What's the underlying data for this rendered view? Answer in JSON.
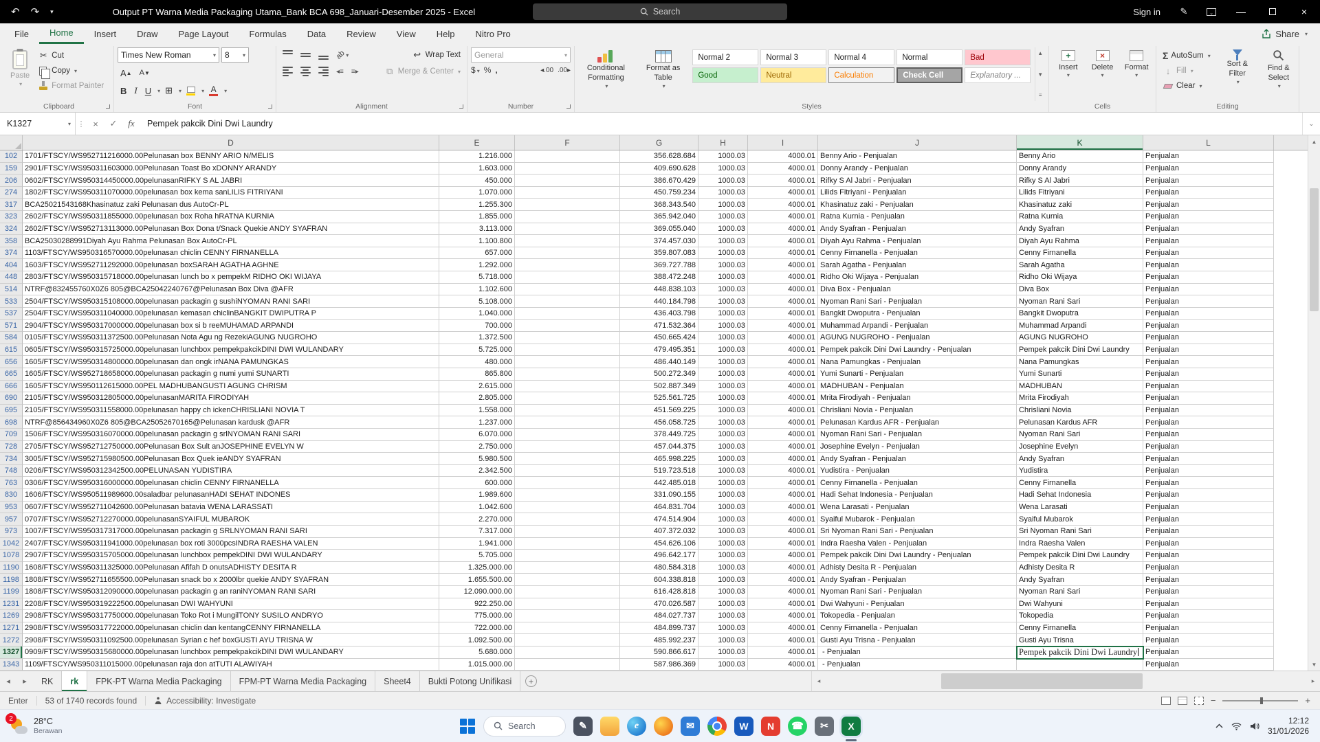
{
  "theme": {
    "excel_green": "#217346",
    "selection_green": "#1e7145",
    "titlebar_black": "#000000",
    "row_number_blue": "#3a66a7"
  },
  "titlebar": {
    "title": "Output PT Warna Media Packaging Utama_Bank BCA 698_Januari-Desember 2025  -  Excel",
    "search_placeholder": "Search",
    "sign_in": "Sign in"
  },
  "ribbon": {
    "tabs": [
      "File",
      "Home",
      "Insert",
      "Draw",
      "Page Layout",
      "Formulas",
      "Data",
      "Review",
      "View",
      "Help",
      "Nitro Pro"
    ],
    "active_tab": "Home",
    "share_label": "Share",
    "clipboard": {
      "label": "Clipboard",
      "paste": "Paste",
      "cut": "Cut",
      "copy": "Copy",
      "format_painter": "Format Painter"
    },
    "font": {
      "label": "Font",
      "font_name": "Times New Roman",
      "font_size": "8"
    },
    "alignment": {
      "label": "Alignment",
      "wrap_text": "Wrap Text",
      "merge_center": "Merge & Center"
    },
    "number": {
      "label": "Number",
      "format": "General"
    },
    "styles": {
      "label": "Styles",
      "conditional": "Conditional Formatting",
      "format_table": "Format as Table",
      "gallery_row1": [
        "Normal 2",
        "Normal 3",
        "Normal 4",
        "Normal",
        "Bad"
      ],
      "gallery_row2": [
        "Good",
        "Neutral",
        "Calculation",
        "Check Cell",
        "Explanatory ..."
      ]
    },
    "cells": {
      "label": "Cells",
      "items": [
        "Insert",
        "Delete",
        "Format"
      ]
    },
    "editing": {
      "label": "Editing",
      "autosum": "AutoSum",
      "fill": "Fill",
      "clear": "Clear",
      "sort": "Sort & Filter",
      "find": "Find & Select"
    }
  },
  "formula_bar": {
    "name_box": "K1327",
    "formula": "Pempek pakcik Dini Dwi Laundry"
  },
  "grid": {
    "columns": [
      "D",
      "E",
      "F",
      "G",
      "H",
      "I",
      "J",
      "K",
      "L"
    ],
    "selected": {
      "row": "1327",
      "col": "K"
    },
    "h_value": "1000.03",
    "i_value": "4000.01",
    "l_value": "Penjualan",
    "rows": [
      {
        "n": "102",
        "d": "1701/FTSCY/WS952711216000.00Pelunasan box BENNY ARIO N/MELIS",
        "e": "1.216.000",
        "g": "356.628.684",
        "j": "Benny Ario - Penjualan",
        "k": "Benny Ario"
      },
      {
        "n": "159",
        "d": "2901/FTSCY/WS950311603000.00Pelunasan Toast Bo xDONNY ARANDY",
        "e": "1.603.000",
        "g": "409.690.628",
        "j": "Donny Arandy - Penjualan",
        "k": "Donny Arandy"
      },
      {
        "n": "206",
        "d": "0602/FTSCY/WS950314450000.00pelunasanRIFKY S AL JABRI",
        "e": "450.000",
        "g": "386.670.429",
        "j": "Rifky S Al Jabri - Penjualan",
        "k": "Rifky S Al Jabri"
      },
      {
        "n": "274",
        "d": "1802/FTSCY/WS950311070000.00pelunasan box kema sanLILIS FITRIYANI",
        "e": "1.070.000",
        "g": "450.759.234",
        "j": "Lilids Fitriyani - Penjualan",
        "k": "Lilids Fitriyani"
      },
      {
        "n": "317",
        "d": "BCA25021543168Khasinatuz zaki Pelunasan dus AutoCr-PL",
        "e": "1.255.300",
        "g": "368.343.540",
        "j": "Khasinatuz zaki - Penjualan",
        "k": "Khasinatuz zaki"
      },
      {
        "n": "323",
        "d": "2602/FTSCY/WS950311855000.00pelunasan box Roha hRATNA KURNIA",
        "e": "1.855.000",
        "g": "365.942.040",
        "j": "Ratna Kurnia - Penjualan",
        "k": "Ratna Kurnia"
      },
      {
        "n": "324",
        "d": "2602/FTSCY/WS952713113000.00Pelunasan Box Dona t/Snack Quekie ANDY SYAFRAN",
        "e": "3.113.000",
        "g": "369.055.040",
        "j": "Andy Syafran - Penjualan",
        "k": "Andy Syafran"
      },
      {
        "n": "358",
        "d": "BCA25030288991Diyah Ayu Rahma Pelunasan Box AutoCr-PL",
        "e": "1.100.800",
        "g": "374.457.030",
        "j": "Diyah Ayu Rahma - Penjualan",
        "k": "Diyah Ayu Rahma"
      },
      {
        "n": "374",
        "d": "1103/FTSCY/WS950316570000.00pelunasan chiclin CENNY FIRNANELLA",
        "e": "657.000",
        "g": "359.807.083",
        "j": "Cenny Firnanella - Penjualan",
        "k": "Cenny Firnanella"
      },
      {
        "n": "404",
        "d": "1603/FTSCY/WS952711292000.00pelunasan boxSARAH AGATHA AGHNE",
        "e": "1.292.000",
        "g": "369.727.788",
        "j": "Sarah Agatha - Penjualan",
        "k": "Sarah Agatha"
      },
      {
        "n": "448",
        "d": "2803/FTSCY/WS950315718000.00pelunasan lunch bo x pempekM RIDHO OKI WIJAYA",
        "e": "5.718.000",
        "g": "388.472.248",
        "j": "Ridho Oki Wijaya - Penjualan",
        "k": "Ridho Oki Wijaya"
      },
      {
        "n": "514",
        "d": "NTRF@832455760X0Z6 805@BCA25042240767@Pelunasan Box Diva @AFR",
        "e": "1.102.600",
        "g": "448.838.103",
        "j": "Diva Box - Penjualan",
        "k": "Diva Box"
      },
      {
        "n": "533",
        "d": "2504/FTSCY/WS950315108000.00pelunasan packagin g sushiNYOMAN RANI SARI",
        "e": "5.108.000",
        "g": "440.184.798",
        "j": "Nyoman Rani Sari - Penjualan",
        "k": "Nyoman Rani Sari"
      },
      {
        "n": "537",
        "d": "2504/FTSCY/WS950311040000.00pelunasan kemasan chiclinBANGKIT DWIPUTRA P",
        "e": "1.040.000",
        "g": "436.403.798",
        "j": "Bangkit Dwoputra - Penjualan",
        "k": "Bangkit Dwoputra"
      },
      {
        "n": "571",
        "d": "2904/FTSCY/WS950317000000.00pelunasan box si b reeMUHAMAD ARPANDI",
        "e": "700.000",
        "g": "471.532.364",
        "j": "Muhammad Arpandi - Penjualan",
        "k": "Muhammad Arpandi"
      },
      {
        "n": "584",
        "d": "0105/FTSCY/WS950311372500.00Pelunasan Nota Agu ng RezekiAGUNG NUGROHO",
        "e": "1.372.500",
        "g": "450.665.424",
        "j": "AGUNG NUGROHO - Penjualan",
        "k": "AGUNG NUGROHO"
      },
      {
        "n": "615",
        "d": "0605/FTSCY/WS950315725000.00pelunasan lunchbox pempekpakcikDINI DWI WULANDARY",
        "e": "5.725.000",
        "g": "479.495.351",
        "j": "Pempek pakcik Dini Dwi Laundry - Penjualan",
        "k": "Pempek pakcik Dini Dwi Laundry"
      },
      {
        "n": "656",
        "d": "1605/FTSCY/WS950314800000.00pelunasan dan ongk irNANA PAMUNGKAS",
        "e": "480.000",
        "g": "486.440.149",
        "j": "Nana Pamungkas - Penjualan",
        "k": "Nana Pamungkas"
      },
      {
        "n": "665",
        "d": "1605/FTSCY/WS952718658000.00pelunasan packagin g numi yumi SUNARTI",
        "e": "865.800",
        "g": "500.272.349",
        "j": "Yumi Sunarti - Penjualan",
        "k": "Yumi Sunarti"
      },
      {
        "n": "666",
        "d": "1605/FTSCY/WS950112615000.00PEL MADHUBANGUSTI AGUNG CHRISM",
        "e": "2.615.000",
        "g": "502.887.349",
        "j": "MADHUBAN - Penjualan",
        "k": "MADHUBAN"
      },
      {
        "n": "690",
        "d": "2105/FTSCY/WS950312805000.00pelunasanMARITA FIRODIYAH",
        "e": "2.805.000",
        "g": "525.561.725",
        "j": "Mrita Firodiyah - Penjualan",
        "k": "Mrita Firodiyah"
      },
      {
        "n": "695",
        "d": "2105/FTSCY/WS950311558000.00pelunasan happy ch ickenCHRISLIANI NOVIA T",
        "e": "1.558.000",
        "g": "451.569.225",
        "j": "Chrisliani Novia - Penjualan",
        "k": "Chrisliani Novia"
      },
      {
        "n": "698",
        "d": "NTRF@856434960X0Z6 805@BCA25052670165@Pelunasan kardusk @AFR",
        "e": "1.237.000",
        "g": "456.058.725",
        "j": "Pelunasan Kardus AFR - Penjualan",
        "k": "Pelunasan Kardus AFR"
      },
      {
        "n": "709",
        "d": "1506/FTSCY/WS950316070000.00pelunasan packagin g srlNYOMAN RANI SARI",
        "e": "6.070.000",
        "g": "378.449.725",
        "j": "Nyoman Rani Sari - Penjualan",
        "k": "Nyoman Rani Sari"
      },
      {
        "n": "728",
        "d": "2705/FTSCY/WS952712750000.00Pelunasan Box Sult anJOSEPHINE EVELYN W",
        "e": "2.750.000",
        "g": "457.044.375",
        "j": "Josephine Evelyn - Penjualan",
        "k": "Josephine Evelyn"
      },
      {
        "n": "734",
        "d": "3005/FTSCY/WS952715980500.00Pelunasan Box Quek ieANDY SYAFRAN",
        "e": "5.980.500",
        "g": "465.998.225",
        "j": "Andy Syafran - Penjualan",
        "k": "Andy Syafran"
      },
      {
        "n": "748",
        "d": "0206/FTSCY/WS950312342500.00PELUNASAN YUDISTIRA",
        "e": "2.342.500",
        "g": "519.723.518",
        "j": "Yudistira - Penjualan",
        "k": "Yudistira"
      },
      {
        "n": "763",
        "d": "0306/FTSCY/WS950316000000.00pelunasan chiclin CENNY FIRNANELLA",
        "e": "600.000",
        "g": "442.485.018",
        "j": "Cenny Firnanella - Penjualan",
        "k": "Cenny Firnanella"
      },
      {
        "n": "830",
        "d": "1606/FTSCY/WS950511989600.00saladbar pelunasanHADI SEHAT INDONES",
        "e": "1.989.600",
        "g": "331.090.155",
        "j": "Hadi Sehat Indonesia - Penjualan",
        "k": "Hadi Sehat Indonesia"
      },
      {
        "n": "953",
        "d": "0607/FTSCY/WS952711042600.00Pelunasan batavia WENA LARASSATI",
        "e": "1.042.600",
        "g": "464.831.704",
        "j": "Wena Larasati - Penjualan",
        "k": "Wena Larasati"
      },
      {
        "n": "957",
        "d": "0707/FTSCY/WS952712270000.00pelunasanSYAIFUL MUBAROK",
        "e": "2.270.000",
        "g": "474.514.904",
        "j": "Syaiful Mubarok - Penjualan",
        "k": "Syaiful Mubarok"
      },
      {
        "n": "973",
        "d": "1007/FTSCY/WS950317317000.00pelunasan packagin g SRLNYOMAN RANI SARI",
        "e": "7.317.000",
        "g": "407.372.032",
        "j": "Sri Nyoman Rani Sari - Penjualan",
        "k": "Sri Nyoman Rani Sari"
      },
      {
        "n": "1042",
        "d": "2407/FTSCY/WS950311941000.00pelunasan box roti 3000pcsINDRA RAESHA VALEN",
        "e": "1.941.000",
        "g": "454.626.106",
        "j": "Indra Raesha Valen - Penjualan",
        "k": "Indra Raesha Valen"
      },
      {
        "n": "1078",
        "d": "2907/FTSCY/WS950315705000.00pelunasan lunchbox pempekDINI DWI WULANDARY",
        "e": "5.705.000",
        "g": "496.642.177",
        "j": "Pempek pakcik Dini Dwi Laundry - Penjualan",
        "k": "Pempek pakcik Dini Dwi Laundry"
      },
      {
        "n": "1190",
        "d": "1608/FTSCY/WS950311325000.00Pelunasan Afifah D onutsADHISTY DESITA R",
        "e": "1.325.000.00",
        "g": "480.584.318",
        "j": "Adhisty Desita R - Penjualan",
        "k": "Adhisty Desita R"
      },
      {
        "n": "1198",
        "d": "1808/FTSCY/WS952711655500.00Pelunasan snack bo x 2000lbr quekie ANDY SYAFRAN",
        "e": "1.655.500.00",
        "g": "604.338.818",
        "j": "Andy Syafran - Penjualan",
        "k": "Andy Syafran"
      },
      {
        "n": "1199",
        "d": "1808/FTSCY/WS950312090000.00pelunasan packagin g an raniNYOMAN RANI SARI",
        "e": "12.090.000.00",
        "g": "616.428.818",
        "j": "Nyoman Rani Sari - Penjualan",
        "k": "Nyoman Rani Sari"
      },
      {
        "n": "1231",
        "d": "2208/FTSCY/WS950319222500.00pelunasan DWI WAHYUNI",
        "e": "922.250.00",
        "g": "470.026.587",
        "j": "Dwi Wahyuni - Penjualan",
        "k": "Dwi Wahyuni"
      },
      {
        "n": "1269",
        "d": "2908/FTSCY/WS950317750000.00pelunasan Toko Rot i MungilTONY SUSILO ANDRYO",
        "e": "775.000.00",
        "g": "484.027.737",
        "j": "Tokopedia - Penjualan",
        "k": "Tokopedia"
      },
      {
        "n": "1271",
        "d": "2908/FTSCY/WS950317722000.00pelunasan chiclin dan kentangCENNY FIRNANELLA",
        "e": "722.000.00",
        "g": "484.899.737",
        "j": "Cenny Firnanella - Penjualan",
        "k": "Cenny Firnanella"
      },
      {
        "n": "1272",
        "d": "2908/FTSCY/WS950311092500.00pelunasan Syrian c hef boxGUSTI AYU TRISNA W",
        "e": "1.092.500.00",
        "g": "485.992.237",
        "j": "Gusti Ayu Trisna - Penjualan",
        "k": "Gusti Ayu Trisna"
      },
      {
        "n": "1327",
        "d": "0909/FTSCY/WS950315680000.00pelunasan lunchbox pempekpakcikDINI DWI WULANDARY",
        "e": "5.680.000",
        "g": "590.866.617",
        "j": " - Penjualan",
        "k": "Pempek pakcik Dini Dwi Laundry"
      },
      {
        "n": "1343",
        "d": "1109/FTSCY/WS950311015000.00pelunasan raja don atTUTI ALAWIYAH",
        "e": "1.015.000.00",
        "g": "587.986.369",
        "j": " - Penjualan",
        "k": ""
      }
    ]
  },
  "sheet_tabs": {
    "tabs": [
      "RK",
      "rk",
      "FPK-PT Warna Media Packaging",
      "FPM-PT Warna Media Packaging",
      "Sheet4",
      "Bukti Potong Unifikasi"
    ],
    "active": "rk"
  },
  "status_bar": {
    "mode": "Enter",
    "records": "53 of 1740 records found",
    "accessibility": "Accessibility: Investigate"
  },
  "taskbar": {
    "badge": "2",
    "temp": "28°C",
    "desc": "Berawan",
    "search": "Search",
    "time": "12:12",
    "date": "31/01/2026",
    "active_app": "excel",
    "icons": [
      {
        "name": "pen",
        "glyph": "✎",
        "bg": "#4b5260"
      },
      {
        "name": "file-explorer",
        "glyph": ""
      },
      {
        "name": "edge",
        "glyph": "e"
      },
      {
        "name": "firefox",
        "glyph": ""
      },
      {
        "name": "mail",
        "glyph": "✉",
        "bg": "#2f7cd6"
      },
      {
        "name": "chrome",
        "glyph": ""
      },
      {
        "name": "word",
        "glyph": "W",
        "bg": "#185abd"
      },
      {
        "name": "nitro-pdf",
        "glyph": "N",
        "bg": "#e43d30"
      },
      {
        "name": "whatsapp",
        "glyph": "☎",
        "bg": "#25d366"
      },
      {
        "name": "snipping-tool",
        "glyph": "✂",
        "bg": "#697079"
      },
      {
        "name": "excel",
        "glyph": "X",
        "bg": "#107c41"
      }
    ]
  }
}
